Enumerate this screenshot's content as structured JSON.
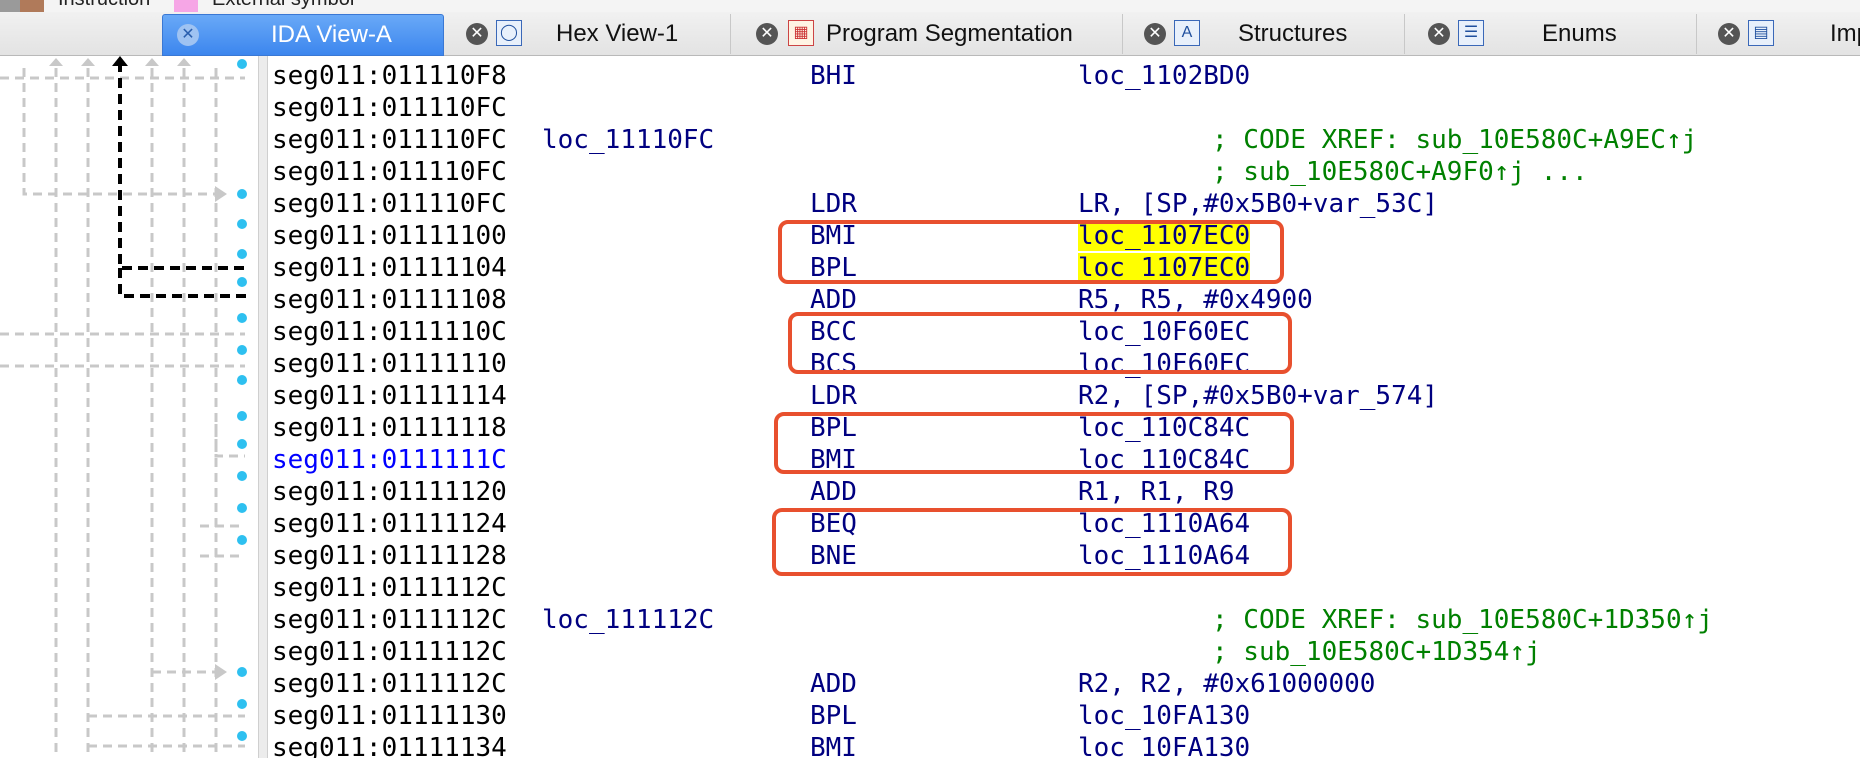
{
  "legend": {
    "items": [
      {
        "label": "Instruction",
        "color": "#b07a5a"
      },
      {
        "label": "External symbol",
        "color": "#f6a6e6"
      }
    ]
  },
  "tabs": [
    {
      "label": "IDA View-A",
      "active": true,
      "icon": "ida-view-icon"
    },
    {
      "label": "Hex View-1",
      "active": false,
      "icon": "hex-view-icon"
    },
    {
      "label": "Program Segmentation",
      "active": false,
      "icon": "segmentation-icon"
    },
    {
      "label": "Structures",
      "active": false,
      "icon": "structures-icon"
    },
    {
      "label": "Enums",
      "active": false,
      "icon": "enums-icon"
    },
    {
      "label": "Imp",
      "active": false,
      "icon": "imports-icon"
    }
  ],
  "tab_close_glyph": "✕",
  "listing": {
    "rows": [
      {
        "addr": "seg011:011110F8",
        "label": "",
        "mnem": "BHI",
        "ops": "loc_1102BD0",
        "comment": ""
      },
      {
        "addr": "seg011:011110FC",
        "label": "",
        "mnem": "",
        "ops": "",
        "comment": ""
      },
      {
        "addr": "seg011:011110FC",
        "label": "loc_11110FC",
        "mnem": "",
        "ops": "",
        "comment": "; CODE XREF: sub_10E580C+A9EC↑j"
      },
      {
        "addr": "seg011:011110FC",
        "label": "",
        "mnem": "",
        "ops": "",
        "comment": "; sub_10E580C+A9F0↑j ..."
      },
      {
        "addr": "seg011:011110FC",
        "label": "",
        "mnem": "LDR",
        "ops": "LR, [SP,#0x5B0+var_53C]",
        "comment": ""
      },
      {
        "addr": "seg011:01111100",
        "label": "",
        "mnem": "BMI",
        "ops": "loc_1107EC0",
        "comment": "",
        "highlight": true
      },
      {
        "addr": "seg011:01111104",
        "label": "",
        "mnem": "BPL",
        "ops": "loc_1107EC0",
        "comment": "",
        "highlight": true
      },
      {
        "addr": "seg011:01111108",
        "label": "",
        "mnem": "ADD",
        "ops": "R5, R5, #0x4900",
        "comment": ""
      },
      {
        "addr": "seg011:0111110C",
        "label": "",
        "mnem": "BCC",
        "ops": "loc_10F60EC",
        "comment": ""
      },
      {
        "addr": "seg011:01111110",
        "label": "",
        "mnem": "BCS",
        "ops": "loc_10F60EC",
        "comment": ""
      },
      {
        "addr": "seg011:01111114",
        "label": "",
        "mnem": "LDR",
        "ops": "R2, [SP,#0x5B0+var_574]",
        "comment": ""
      },
      {
        "addr": "seg011:01111118",
        "label": "",
        "mnem": "BPL",
        "ops": "loc_110C84C",
        "comment": ""
      },
      {
        "addr": "seg011:0111111C",
        "label": "",
        "mnem": "BMI",
        "ops": "loc_110C84C",
        "comment": "",
        "current": true
      },
      {
        "addr": "seg011:01111120",
        "label": "",
        "mnem": "ADD",
        "ops": "R1, R1, R9",
        "comment": ""
      },
      {
        "addr": "seg011:01111124",
        "label": "",
        "mnem": "BEQ",
        "ops": "loc_1110A64",
        "comment": ""
      },
      {
        "addr": "seg011:01111128",
        "label": "",
        "mnem": "BNE",
        "ops": "loc_1110A64",
        "comment": ""
      },
      {
        "addr": "seg011:0111112C",
        "label": "",
        "mnem": "",
        "ops": "",
        "comment": ""
      },
      {
        "addr": "seg011:0111112C",
        "label": "loc_111112C",
        "mnem": "",
        "ops": "",
        "comment": "; CODE XREF: sub_10E580C+1D350↑j"
      },
      {
        "addr": "seg011:0111112C",
        "label": "",
        "mnem": "",
        "ops": "",
        "comment": "; sub_10E580C+1D354↑j"
      },
      {
        "addr": "seg011:0111112C",
        "label": "",
        "mnem": "ADD",
        "ops": "R2, R2, #0x61000000",
        "comment": ""
      },
      {
        "addr": "seg011:01111130",
        "label": "",
        "mnem": "BPL",
        "ops": "loc_10FA130",
        "comment": ""
      },
      {
        "addr": "seg011:01111134",
        "label": "",
        "mnem": "BMI",
        "ops": "loc_10FA130",
        "comment": ""
      }
    ]
  },
  "colors": {
    "address": "#000000",
    "current_address": "#0000ff",
    "mnemonic": "#000080",
    "comment": "#008000",
    "highlight": "#ffff00",
    "annotation_box": "#e8502e",
    "tab_active": "#3c86ee"
  }
}
